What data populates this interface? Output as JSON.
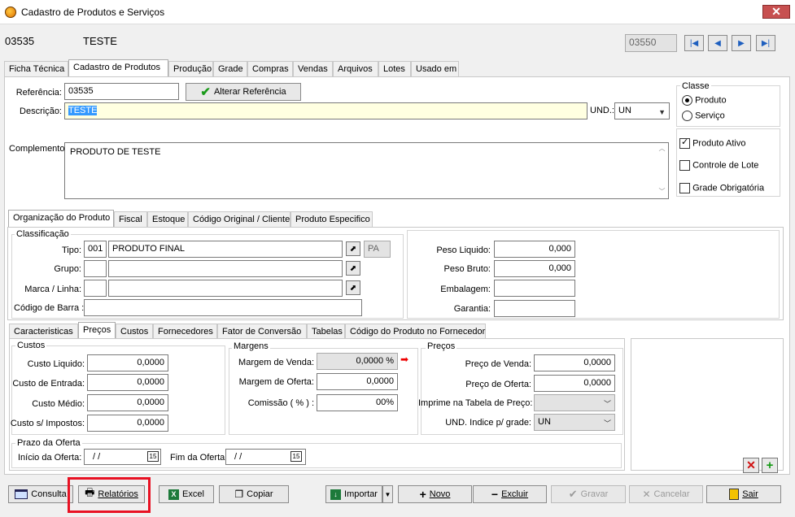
{
  "window": {
    "title": "Cadastro de Produtos e Serviços",
    "close": "✕"
  },
  "header": {
    "code": "03535",
    "name": "TESTE",
    "record_field": "03550"
  },
  "main_tabs": [
    "Ficha Técnica",
    "Cadastro de Produtos",
    "Produção",
    "Grade",
    "Compras",
    "Vendas",
    "Arquivos",
    "Lotes",
    "Usado em"
  ],
  "form": {
    "referencia_label": "Referência:",
    "referencia_value": "03535",
    "alterar_button": "Alterar Referência",
    "descricao_label": "Descrição:",
    "descricao_value": "TESTE",
    "und_label": "UND.:",
    "und_value": "UN",
    "complemento_label": "Complemento:",
    "complemento_value": "PRODUTO DE TESTE"
  },
  "classe": {
    "title": "Classe",
    "produto": "Produto",
    "servico": "Serviço"
  },
  "flags": {
    "ativo": "Produto Ativo",
    "lote": "Controle de Lote",
    "grade": "Grade Obrigatória"
  },
  "org_tabs": [
    "Organização do Produto",
    "Fiscal",
    "Estoque",
    "Código Original / Cliente",
    "Produto Especifico"
  ],
  "classificacao": {
    "title": "Classificação",
    "tipo_label": "Tipo:",
    "tipo_code": "001",
    "tipo_name": "PRODUTO FINAL",
    "tipo_abbr": "PA",
    "grupo_label": "Grupo:",
    "marca_label": "Marca / Linha:",
    "barra_label": "Código de Barra :"
  },
  "pesos": {
    "liquido_label": "Peso Liquido:",
    "liquido_value": "0,000",
    "bruto_label": "Peso Bruto:",
    "bruto_value": "0,000",
    "embalagem_label": "Embalagem:",
    "garantia_label": "Garantia:"
  },
  "sub_tabs": [
    "Caracteristicas",
    "Preços",
    "Custos",
    "Fornecedores",
    "Fator de Conversão",
    "Tabelas",
    "Código do Produto no Fornecedor"
  ],
  "custos": {
    "title": "Custos",
    "liquido_label": "Custo Liquido:",
    "liquido_value": "0,0000",
    "entrada_label": "Custo de Entrada:",
    "entrada_value": "0,0000",
    "medio_label": "Custo Médio:",
    "medio_value": "0,0000",
    "impostos_label": "Custo s/ Impostos:",
    "impostos_value": "0,0000"
  },
  "margens": {
    "title": "Margens",
    "venda_label": "Margem de Venda:",
    "venda_value": "0,0000 %",
    "oferta_label": "Margem de Oferta:",
    "oferta_value": "0,0000",
    "comissao_label": "Comissão ( % ) :",
    "comissao_value": "00%"
  },
  "precos": {
    "title": "Preços",
    "venda_label": "Preço de Venda:",
    "venda_value": "0,0000",
    "oferta_label": "Preço de Oferta:",
    "oferta_value": "0,0000",
    "tabela_label": "Imprime na Tabela de Preço:",
    "und_grade_label": "UND. Indice p/ grade:",
    "und_grade_value": "UN"
  },
  "prazo": {
    "title": "Prazo da Oferta",
    "inicio_label": "Início da Oferta:",
    "inicio_value": "/ /",
    "fim_label": "Fim da Oferta:",
    "fim_value": "/ /"
  },
  "toolbar": {
    "consulta": "Consulta",
    "relatorios": "Relatórios",
    "excel": "Excel",
    "copiar": "Copiar",
    "importar": "Importar",
    "novo": "Novo",
    "excluir": "Excluir",
    "gravar": "Gravar",
    "cancelar": "Cancelar",
    "sair": "Sair"
  },
  "colors": {
    "highlight": "#e81123",
    "accent": "#1e5fbf",
    "selection": "#3399ff"
  }
}
